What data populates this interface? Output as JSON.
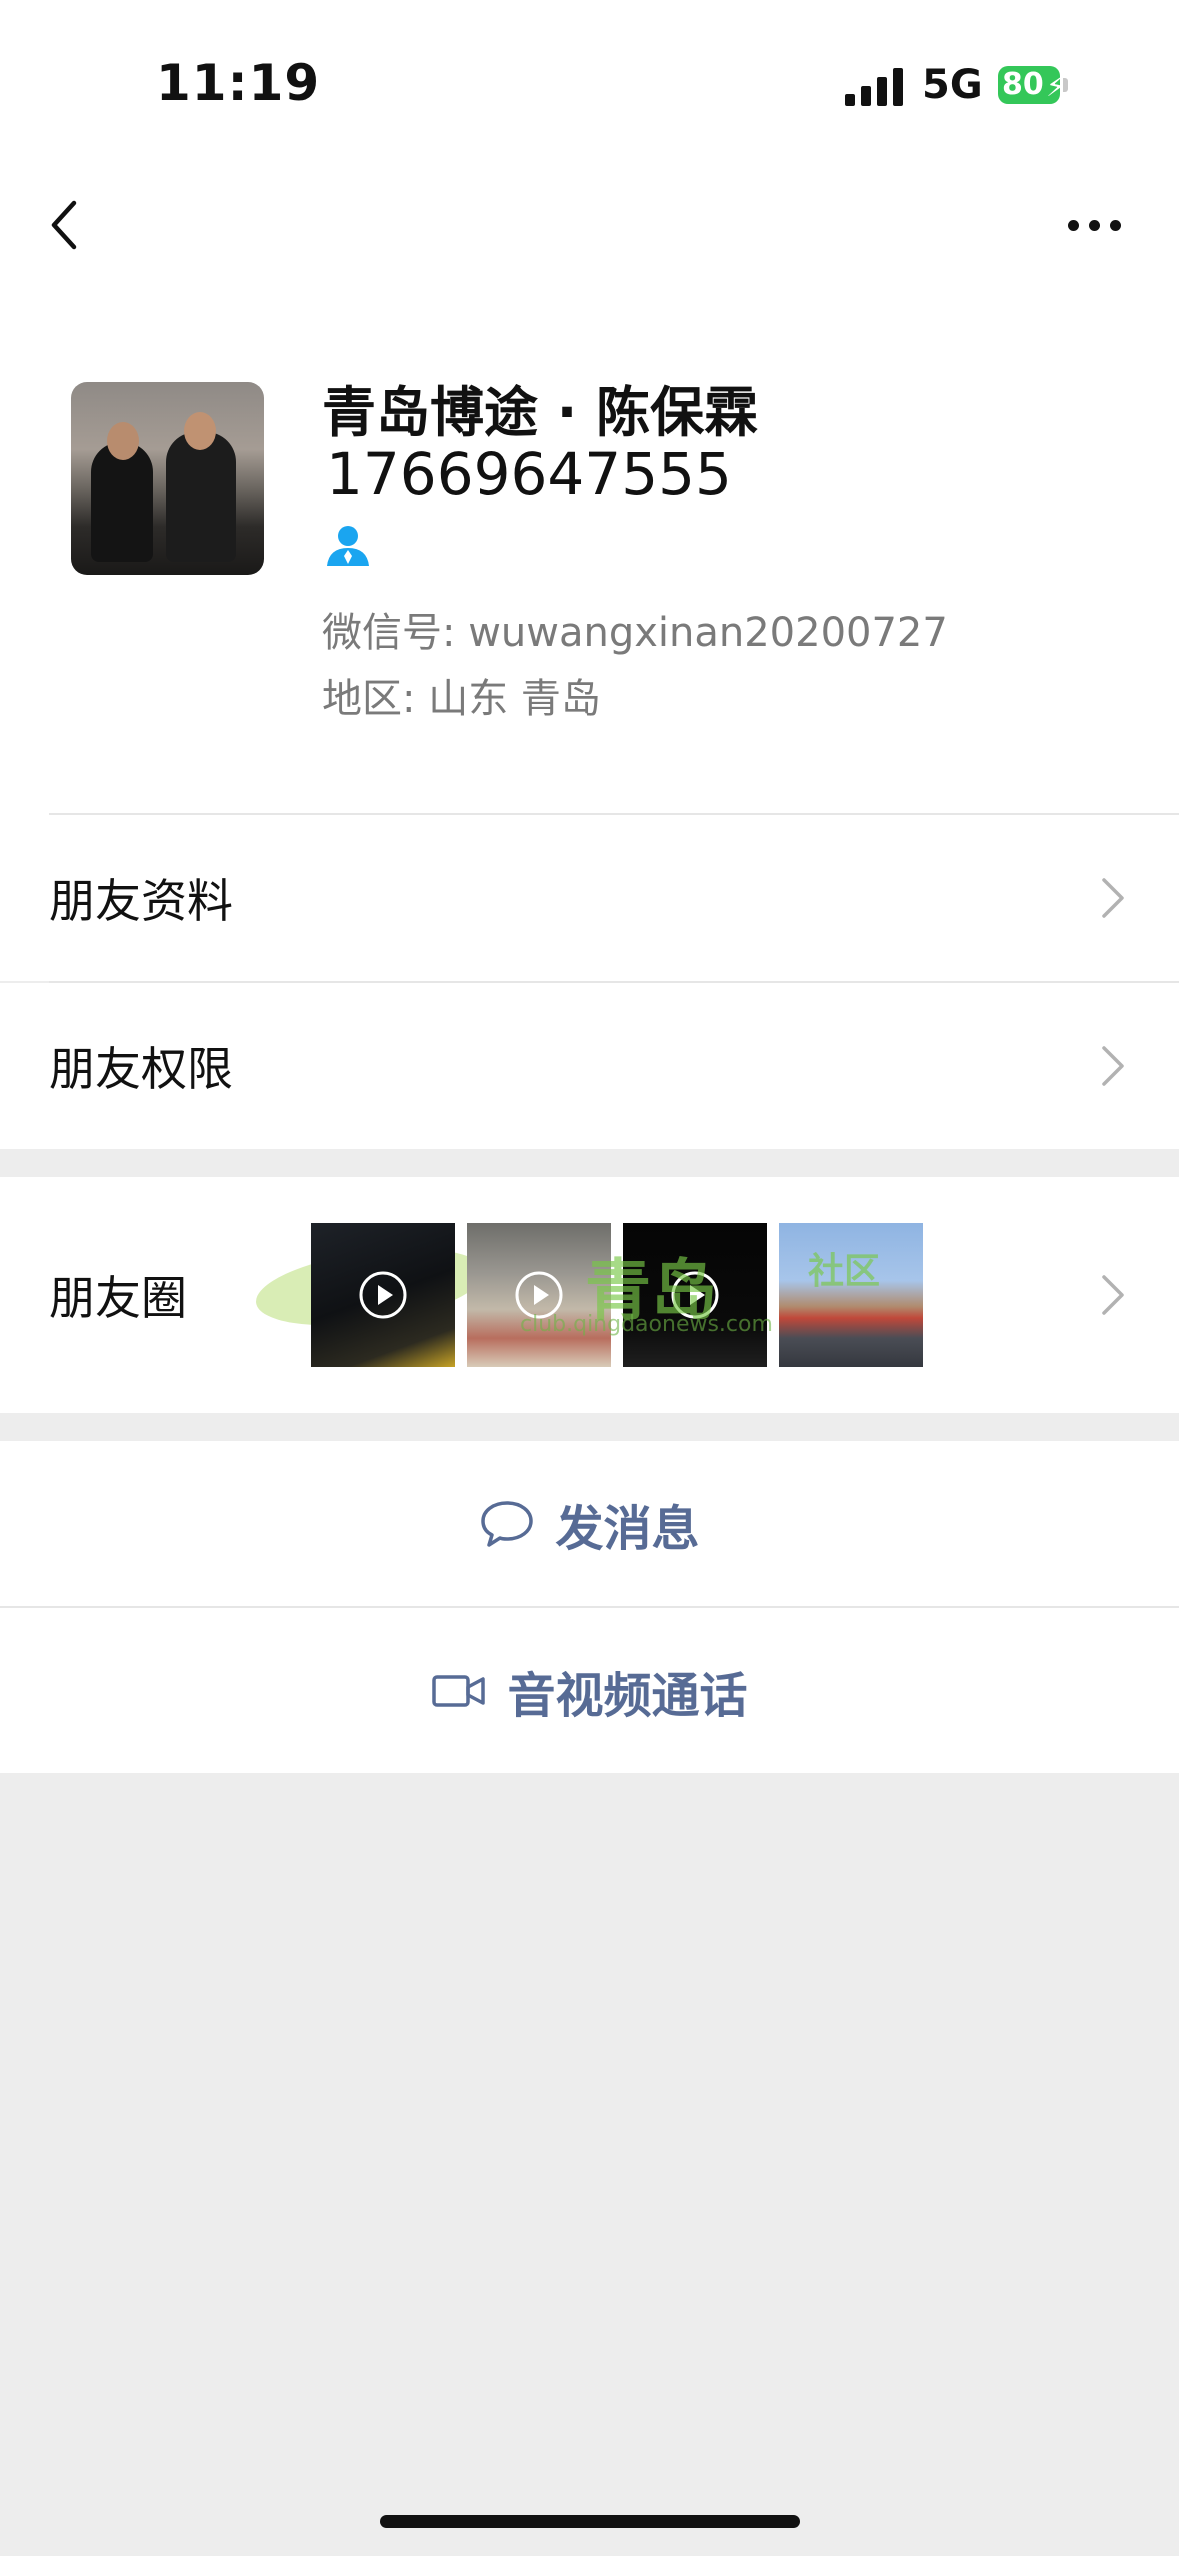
{
  "status_bar": {
    "time": "11:19",
    "network": "5G",
    "battery": "80"
  },
  "nav": {
    "back_icon": "chevron-left-icon",
    "more_icon": "more-dots-icon"
  },
  "profile": {
    "name": "青岛博途 · 陈保霖",
    "phone": "17669647555",
    "wechat_id": "微信号: wuwangxinan20200727",
    "region": "地区: 山东 青岛",
    "contact_icon_color": "#1aa5f0"
  },
  "rows": {
    "friend_info": "朋友资料",
    "friend_permissions": "朋友权限"
  },
  "moments": {
    "label": "朋友圈",
    "watermark_text": "青岛",
    "watermark_sub": "社区",
    "watermark_url": "club.qingdaonews.com"
  },
  "actions": {
    "message": "发消息",
    "call": "音视频通话"
  },
  "colors": {
    "accent": "#576b95",
    "background": "#ededed",
    "panel": "#ffffff"
  }
}
